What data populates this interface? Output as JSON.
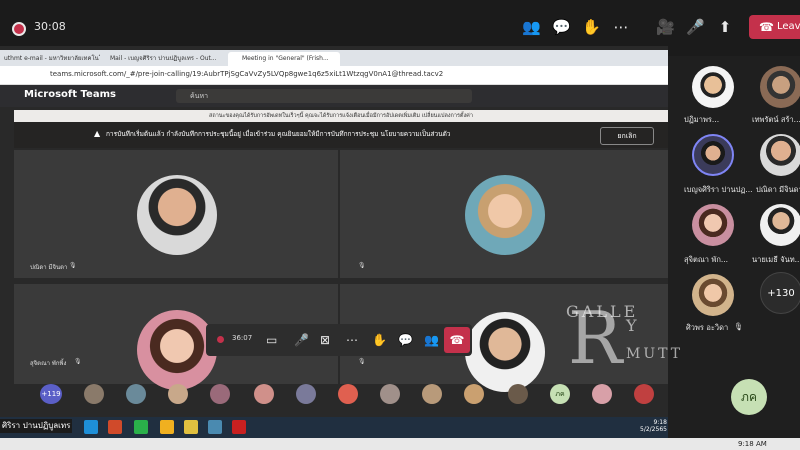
{
  "meeting": {
    "timer": "30:08",
    "leave_label": "Leave",
    "colors": {
      "accent": "#c4314b",
      "background": "#1f1f1f",
      "teams_purple": "#5b5fc7"
    }
  },
  "toolbar_icons": [
    "people-icon",
    "chat-icon",
    "raise-hand-icon",
    "more-icon",
    "camera-off-icon",
    "mic-off-icon",
    "share-icon"
  ],
  "browser": {
    "tabs": [
      {
        "label": "uthmt e-mail - มหาวิทยาลัยเทคโนโลยีร..."
      },
      {
        "label": "Mail - เบญจศิริรา ปานปฏิบูลเทร - Out..."
      },
      {
        "label": "Meeting in \"General\" (Frish..."
      }
    ],
    "url": "teams.microsoft.com/_#/pre-join-calling/19:AubrTPjSgCaVvZy5LVQp8gwe1q6z5xiLt1WtzqgV0nA1@thread.tacv2"
  },
  "teams": {
    "app_title": "Microsoft Teams",
    "search_placeholder": "ค้นหา",
    "notice_banner": "สถานะของคุณได้รับการอัพเดทในเร็วๆนี้ คุณจะได้รับการแจ้งเตือนเมื่อมีการอัปเดตเพิ่มเติม เปลี่ยนแปลงการตั้งค่า",
    "recording_banner": "การบันทึกเริ่มต้นแล้ว กำลังบันทึกการประชุมนี้อยู่ เมื่อเข้าร่วม คุณยินยอมให้มีการบันทึกการประชุม นโยบายความเป็นส่วนตัว",
    "dismiss_label": "ยกเลิก"
  },
  "shared_tiles": [
    {
      "name": "ปณิดา มีจินดา"
    },
    {
      "name": ""
    },
    {
      "name": "สุจิตณา พักพิ้ง"
    },
    {
      "name": ""
    }
  ],
  "shared_callbar": {
    "timer": "36:07"
  },
  "participant_strip": {
    "extra_count": "+119",
    "initials": "ภค"
  },
  "taskbar": {
    "time": "9:18",
    "date": "5/2/2565"
  },
  "gallery": [
    {
      "name": "ปฏิมาพร...",
      "color": "#c9a66b"
    },
    {
      "name": "เทพรัตน์ สร้า...",
      "color": "#8a6a55"
    },
    {
      "name": "เบญจศิริรา ปานปฏ...",
      "color": "#3b3b5a"
    },
    {
      "name": "ปณิดา มีจินดา",
      "color": "#d9a88a"
    },
    {
      "name": "สุจิตณา พัก...",
      "color": "#c98fa0"
    },
    {
      "name": "นายเมธี จันท...",
      "color": "#9a8f7d"
    },
    {
      "name": "ศิวพร อะวิดา",
      "color": "#d2b48c"
    }
  ],
  "gallery_more": "+130",
  "self_initials": "ภค",
  "watermark": {
    "letter": "R",
    "top_word": "GALLE",
    "right_word": "Y",
    "bottom_word": "MUTT"
  },
  "caption_name": "ศิริรา ปานปฏิบูลเทร",
  "system_clock": "9:18 AM"
}
